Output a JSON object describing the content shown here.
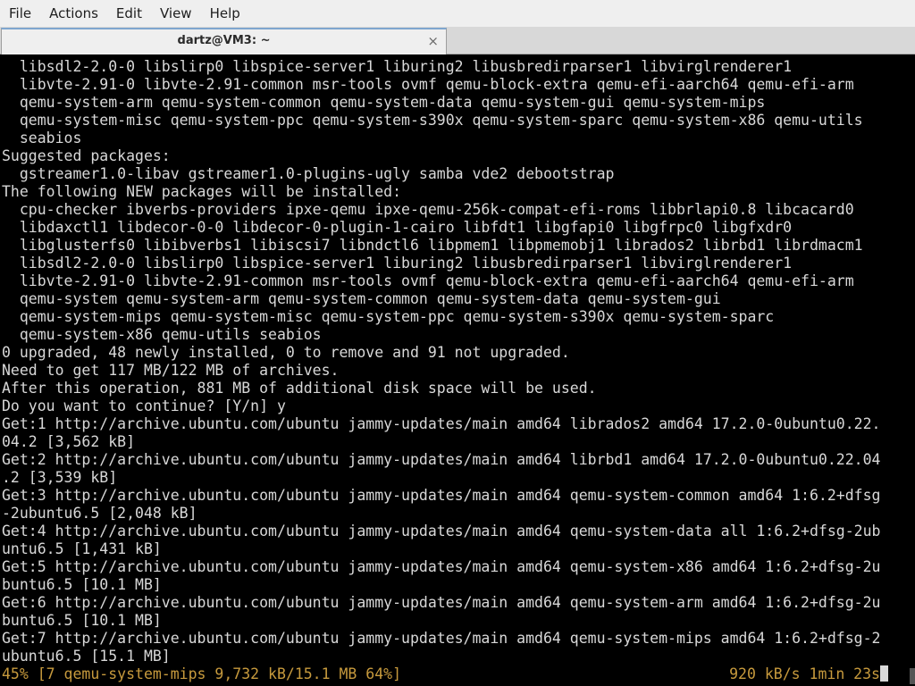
{
  "menu": {
    "file": "File",
    "actions": "Actions",
    "edit": "Edit",
    "view": "View",
    "help": "Help"
  },
  "tab": {
    "title": "dartz@VM3: ~",
    "close": "×"
  },
  "terminal": {
    "lines": [
      "  libsdl2-2.0-0 libslirp0 libspice-server1 liburing2 libusbredirparser1 libvirglrenderer1",
      "  libvte-2.91-0 libvte-2.91-common msr-tools ovmf qemu-block-extra qemu-efi-aarch64 qemu-efi-arm",
      "  qemu-system-arm qemu-system-common qemu-system-data qemu-system-gui qemu-system-mips",
      "  qemu-system-misc qemu-system-ppc qemu-system-s390x qemu-system-sparc qemu-system-x86 qemu-utils",
      "  seabios",
      "Suggested packages:",
      "  gstreamer1.0-libav gstreamer1.0-plugins-ugly samba vde2 debootstrap",
      "The following NEW packages will be installed:",
      "  cpu-checker ibverbs-providers ipxe-qemu ipxe-qemu-256k-compat-efi-roms libbrlapi0.8 libcacard0",
      "  libdaxctl1 libdecor-0-0 libdecor-0-plugin-1-cairo libfdt1 libgfapi0 libgfrpc0 libgfxdr0",
      "  libglusterfs0 libibverbs1 libiscsi7 libndctl6 libpmem1 libpmemobj1 librados2 librbd1 librdmacm1",
      "  libsdl2-2.0-0 libslirp0 libspice-server1 liburing2 libusbredirparser1 libvirglrenderer1",
      "  libvte-2.91-0 libvte-2.91-common msr-tools ovmf qemu-block-extra qemu-efi-aarch64 qemu-efi-arm",
      "  qemu-system qemu-system-arm qemu-system-common qemu-system-data qemu-system-gui",
      "  qemu-system-mips qemu-system-misc qemu-system-ppc qemu-system-s390x qemu-system-sparc",
      "  qemu-system-x86 qemu-utils seabios",
      "0 upgraded, 48 newly installed, 0 to remove and 91 not upgraded.",
      "Need to get 117 MB/122 MB of archives.",
      "After this operation, 881 MB of additional disk space will be used.",
      "Do you want to continue? [Y/n] y",
      "Get:1 http://archive.ubuntu.com/ubuntu jammy-updates/main amd64 librados2 amd64 17.2.0-0ubuntu0.22.",
      "04.2 [3,562 kB]",
      "Get:2 http://archive.ubuntu.com/ubuntu jammy-updates/main amd64 librbd1 amd64 17.2.0-0ubuntu0.22.04",
      ".2 [3,539 kB]",
      "Get:3 http://archive.ubuntu.com/ubuntu jammy-updates/main amd64 qemu-system-common amd64 1:6.2+dfsg",
      "-2ubuntu6.5 [2,048 kB]",
      "Get:4 http://archive.ubuntu.com/ubuntu jammy-updates/main amd64 qemu-system-data all 1:6.2+dfsg-2ub",
      "untu6.5 [1,431 kB]",
      "Get:5 http://archive.ubuntu.com/ubuntu jammy-updates/main amd64 qemu-system-x86 amd64 1:6.2+dfsg-2u",
      "buntu6.5 [10.1 MB]",
      "Get:6 http://archive.ubuntu.com/ubuntu jammy-updates/main amd64 qemu-system-arm amd64 1:6.2+dfsg-2u",
      "buntu6.5 [10.1 MB]",
      "Get:7 http://archive.ubuntu.com/ubuntu jammy-updates/main amd64 qemu-system-mips amd64 1:6.2+dfsg-2",
      "ubuntu6.5 [15.1 MB]"
    ],
    "status_left": "45% [7 qemu-system-mips 9,732 kB/15.1 MB 64%]",
    "status_right": "920 kB/s 1min 23s",
    "colors": {
      "background": "#000000",
      "foreground": "#d8d8d8",
      "status": "#c79a3d"
    }
  }
}
